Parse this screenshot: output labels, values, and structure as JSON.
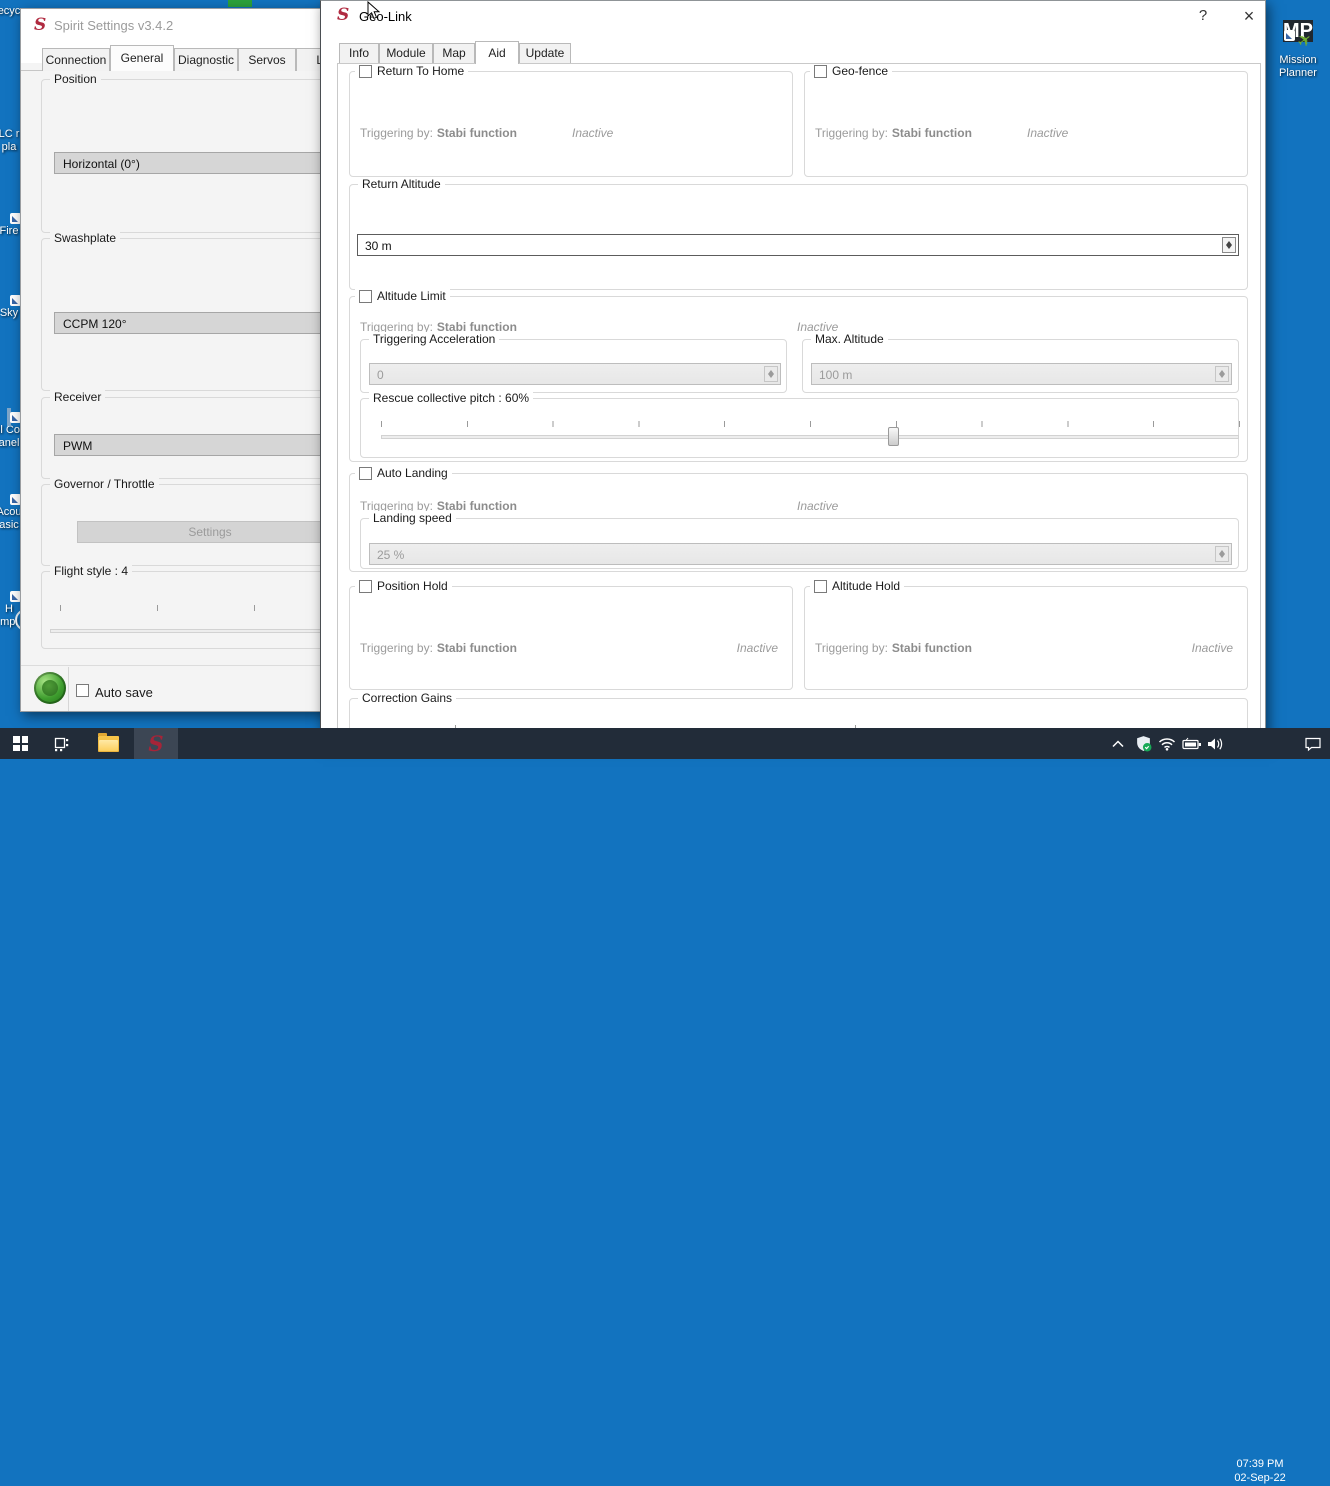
{
  "desktop": {
    "background_color": "#1273bf",
    "icons": [
      {
        "name": "recycle-bin",
        "line1": "ecyc",
        "line2": ""
      },
      {
        "name": "vlc-media-player",
        "line1": "LC r",
        "line2": "pla"
      },
      {
        "name": "firefox",
        "line1": "Fire",
        "line2": ""
      },
      {
        "name": "skype",
        "line1": "Sky",
        "line2": ""
      },
      {
        "name": "control-panel",
        "line1": "ll Co",
        "line2": "anel"
      },
      {
        "name": "acoustica-basic",
        "line1": "Acou",
        "line2": "asic"
      },
      {
        "name": "radio-tool",
        "line1": "H",
        "line2": "mpl"
      }
    ],
    "mission_planner": {
      "logo_text": "MP",
      "plane_glyph": "✈",
      "line1": "Mission",
      "line2": "Planner"
    }
  },
  "spirit": {
    "logo_glyph": "S",
    "title": "Spirit Settings v3.4.2",
    "tabs": [
      "Connection",
      "General",
      "Diagnostic",
      "Servos",
      "Li"
    ],
    "active_tab": "General",
    "position": {
      "label": "Position",
      "value": "Horizontal (0°)"
    },
    "swashplate": {
      "label": "Swashplate",
      "value": "CCPM 120°"
    },
    "receiver": {
      "label": "Receiver",
      "value": "PWM"
    },
    "governor": {
      "label": "Governor / Throttle",
      "settings_button": "Settings"
    },
    "flight_style": {
      "label": "Flight style : 4"
    },
    "auto_save": {
      "label": "Auto save",
      "checked": false
    }
  },
  "geolink": {
    "logo_glyph": "S",
    "title": "Geo-Link",
    "help_button": "?",
    "close_button": "×",
    "tabs": [
      "Info",
      "Module",
      "Map",
      "Aid",
      "Update"
    ],
    "active_tab": "Aid",
    "trigger_label": "Triggering by:",
    "trigger_value": "Stabi function",
    "status_inactive": "Inactive",
    "return_to_home": {
      "label": "Return To Home",
      "checked": false
    },
    "geo_fence": {
      "label": "Geo-fence",
      "checked": false
    },
    "return_altitude": {
      "label": "Return Altitude",
      "value": "30 m"
    },
    "altitude_limit": {
      "label": "Altitude Limit",
      "checked": false,
      "triggering_acceleration": {
        "label": "Triggering Acceleration",
        "value": "0"
      },
      "max_altitude": {
        "label": "Max. Altitude",
        "value": "100 m"
      },
      "rescue_pitch": {
        "label": "Rescue collective pitch : 60%",
        "percent": 60
      }
    },
    "auto_landing": {
      "label": "Auto Landing",
      "checked": false,
      "landing_speed": {
        "label": "Landing speed",
        "value": "25 %"
      }
    },
    "position_hold": {
      "label": "Position Hold",
      "checked": false
    },
    "altitude_hold": {
      "label": "Altitude Hold",
      "checked": false
    },
    "correction_gains": {
      "label": "Correction Gains"
    }
  },
  "taskbar": {
    "time": "07:39 PM",
    "date": "02-Sep-22"
  }
}
